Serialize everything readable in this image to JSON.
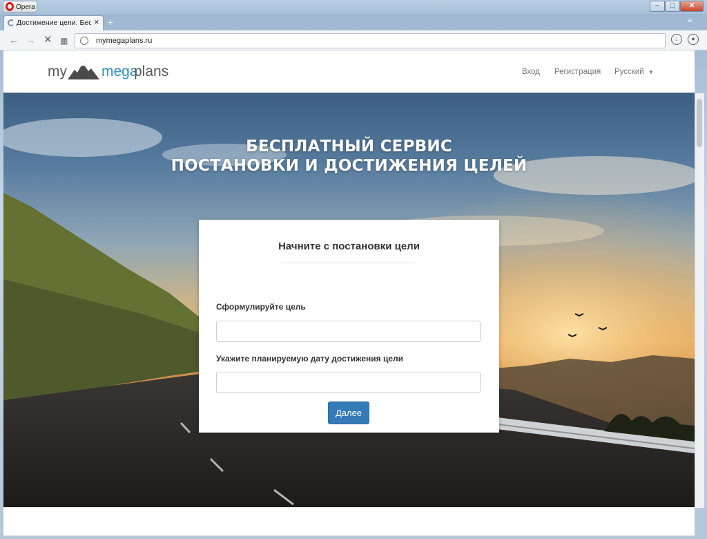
{
  "browser": {
    "app_name": "Opera",
    "tab_title": "Достижение цели. Бесплатный сервис",
    "address": "mymegaplans.ru",
    "icons": {
      "back": "arrow-left-icon",
      "forward": "arrow-right-icon",
      "stop": "close-icon",
      "speed_dial": "grid-icon",
      "downloads": "download-icon",
      "account": "user-icon"
    }
  },
  "site": {
    "logo": {
      "my": "my",
      "mega": "mega",
      "plans": "plans",
      "accent_color": "#2a90c8"
    },
    "nav": {
      "login": "Вход",
      "register": "Регистрация",
      "language": "Русский"
    },
    "hero": {
      "title_line1": "БЕСПЛАТНЫЙ СЕРВИС",
      "title_line2": "ПОСТАНОВКИ И ДОСТИЖЕНИЯ ЦЕЛЕЙ"
    },
    "form": {
      "title": "Начните с постановки цели",
      "goal_label": "Сформулируйте цель",
      "goal_value": "",
      "date_label": "Укажите планируемую дату достижения цели",
      "date_value": "",
      "submit_label": "Далее",
      "button_color": "#337ab7"
    }
  }
}
